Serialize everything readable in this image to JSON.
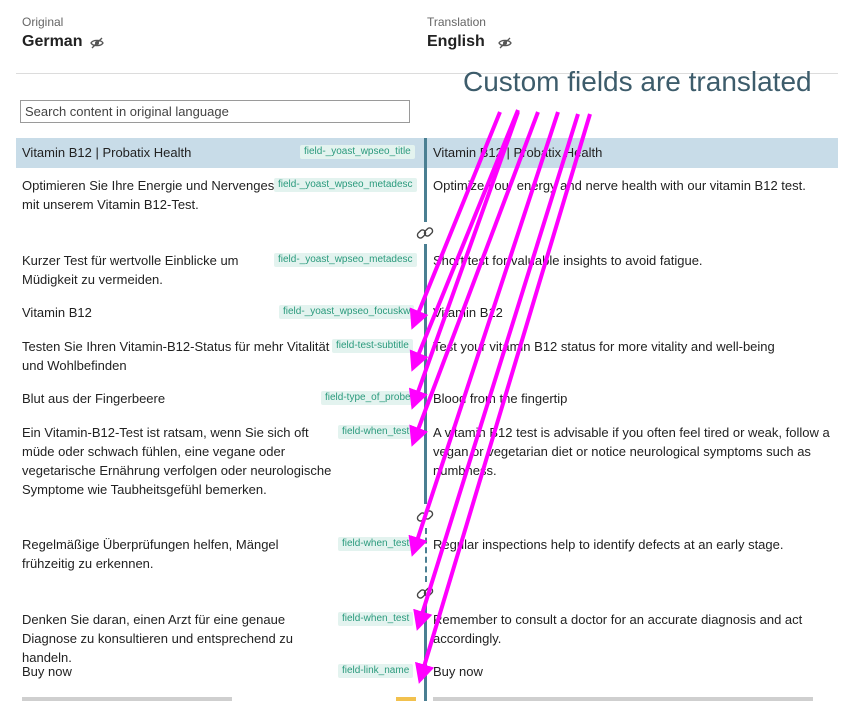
{
  "header": {
    "original_label": "Original",
    "original_lang": "German",
    "translation_label": "Translation",
    "translation_lang": "English"
  },
  "search": {
    "placeholder": "Search content in original language"
  },
  "annotation": {
    "text": "Custom fields are translated",
    "color": "#ff00ff"
  },
  "rows": [
    {
      "original": "Vitamin B12 | Probatix Health",
      "field": "field-_yoast_wpseo_title",
      "translation": "Vitamin B12 | Probatix Health"
    },
    {
      "original": "Optimieren Sie Ihre Energie und Nervengesundheit mit unserem Vitamin B12-Test.",
      "field": "field-_yoast_wpseo_metadesc",
      "translation": "Optimize your energy and nerve health with our vitamin B12 test."
    },
    {
      "original": "Kurzer Test für wertvolle Einblicke um Müdigkeit zu vermeiden.",
      "field": "field-_yoast_wpseo_metadesc",
      "translation": "Short test for valuable insights to avoid fatigue."
    },
    {
      "original": "Vitamin B12",
      "field": "field-_yoast_wpseo_focuskw",
      "translation": "Vitamin B12"
    },
    {
      "original": "Testen Sie Ihren Vitamin-B12-Status für mehr Vitalität und Wohlbefinden",
      "field": "field-test-subtitle",
      "translation": "Test your vitamin B12 status for more vitality and well-being"
    },
    {
      "original": "Blut aus der Fingerbeere",
      "field": "field-type_of_probe",
      "translation": "Blood from the fingertip"
    },
    {
      "original": "Ein Vitamin-B12-Test ist ratsam, wenn Sie sich oft müde oder schwach fühlen, eine vegane oder vegetarische Ernährung verfolgen oder neurologische Symptome wie Taubheitsgefühl bemerken.",
      "field": "field-when_test",
      "translation": "A vitamin B12 test is advisable if you often feel tired or weak, follow a vegan or vegetarian diet or notice neurological symptoms such as numbness."
    },
    {
      "original": "Regelmäßige Überprüfungen helfen, Mängel frühzeitig zu erkennen.",
      "field": "field-when_test",
      "translation": "Regular inspections help to identify defects at an early stage."
    },
    {
      "original": "Denken Sie daran, einen Arzt für eine genaue Diagnose zu konsultieren und entsprechend zu handeln.",
      "field": "field-when_test",
      "translation": "Remember to consult a doctor for an accurate diagnosis and act accordingly."
    },
    {
      "original": "Buy now",
      "field": "field-link_name",
      "translation": "Buy now"
    }
  ]
}
